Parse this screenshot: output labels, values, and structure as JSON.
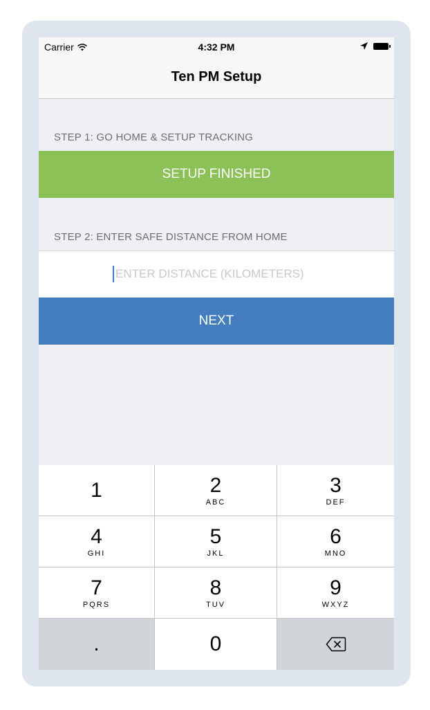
{
  "status_bar": {
    "carrier": "Carrier",
    "time": "4:32 PM"
  },
  "nav": {
    "title": "Ten PM Setup"
  },
  "step1": {
    "label": "STEP 1: GO HOME & SETUP TRACKING",
    "button": "SETUP FINISHED"
  },
  "step2": {
    "label": "STEP 2: ENTER SAFE DISTANCE FROM HOME",
    "placeholder": "ENTER DISTANCE (KILOMETERS)",
    "value": "",
    "button": "NEXT"
  },
  "colors": {
    "green": "#8bc157",
    "blue": "#437dbd"
  },
  "keypad": {
    "keys": [
      {
        "num": "1",
        "letters": ""
      },
      {
        "num": "2",
        "letters": "ABC"
      },
      {
        "num": "3",
        "letters": "DEF"
      },
      {
        "num": "4",
        "letters": "GHI"
      },
      {
        "num": "5",
        "letters": "JKL"
      },
      {
        "num": "6",
        "letters": "MNO"
      },
      {
        "num": "7",
        "letters": "PQRS"
      },
      {
        "num": "8",
        "letters": "TUV"
      },
      {
        "num": "9",
        "letters": "WXYZ"
      },
      {
        "num": ".",
        "letters": ""
      },
      {
        "num": "0",
        "letters": ""
      }
    ],
    "delete_icon": "backspace-icon"
  }
}
